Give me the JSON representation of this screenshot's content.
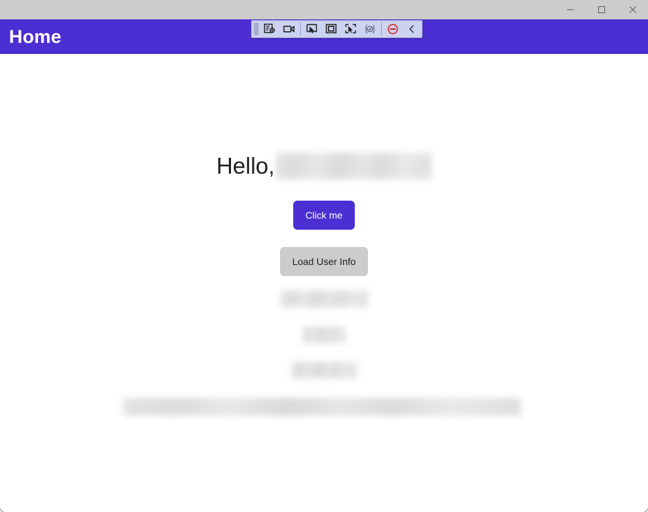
{
  "window": {
    "titlebar": {
      "background_color": "#cccccc",
      "controls": [
        {
          "name": "minimize",
          "label": "Minimize",
          "glyph": "minimize-icon"
        },
        {
          "name": "maximize",
          "label": "Maximize",
          "glyph": "maximize-icon"
        },
        {
          "name": "close",
          "label": "Close",
          "glyph": "close-icon"
        }
      ]
    }
  },
  "header": {
    "title": "Home",
    "background_color": "#4c2fd2",
    "text_color": "#ffffff"
  },
  "automation_toolbar": {
    "background_color": "#ccd2ef",
    "border_color": "#9aa2cc",
    "grip": "drag-handle-grip",
    "buttons": [
      {
        "name": "inspect-target",
        "icon": "inspect-element-icon",
        "label": "Inspect element"
      },
      {
        "name": "record",
        "icon": "video-camera-icon",
        "label": "Record"
      },
      {
        "name": "pick-element",
        "icon": "cursor-pointer-icon",
        "label": "Pick element"
      },
      {
        "name": "select-region",
        "icon": "square-frame-icon",
        "label": "Select region"
      },
      {
        "name": "pick-region-cursor",
        "icon": "cursor-frame-icon",
        "label": "Pick region"
      },
      {
        "name": "assert",
        "icon": "check-circle-icon",
        "label": "Assert"
      },
      {
        "name": "stop",
        "icon": "stop-circle-icon",
        "label": "Stop",
        "color": "#d42a2a"
      },
      {
        "name": "collapse",
        "icon": "chevron-left-icon",
        "label": "Collapse toolbar"
      }
    ]
  },
  "main": {
    "greeting_prefix": "Hello,",
    "greeting_name_redacted": true,
    "buttons": {
      "primary": "Click me",
      "secondary": "Load User Info"
    },
    "placeholders": [
      {
        "name": "user-info-line-1",
        "redacted": true
      },
      {
        "name": "user-info-line-2",
        "redacted": true
      },
      {
        "name": "user-info-line-3",
        "redacted": true
      },
      {
        "name": "user-info-wide-block",
        "redacted": true
      }
    ]
  }
}
